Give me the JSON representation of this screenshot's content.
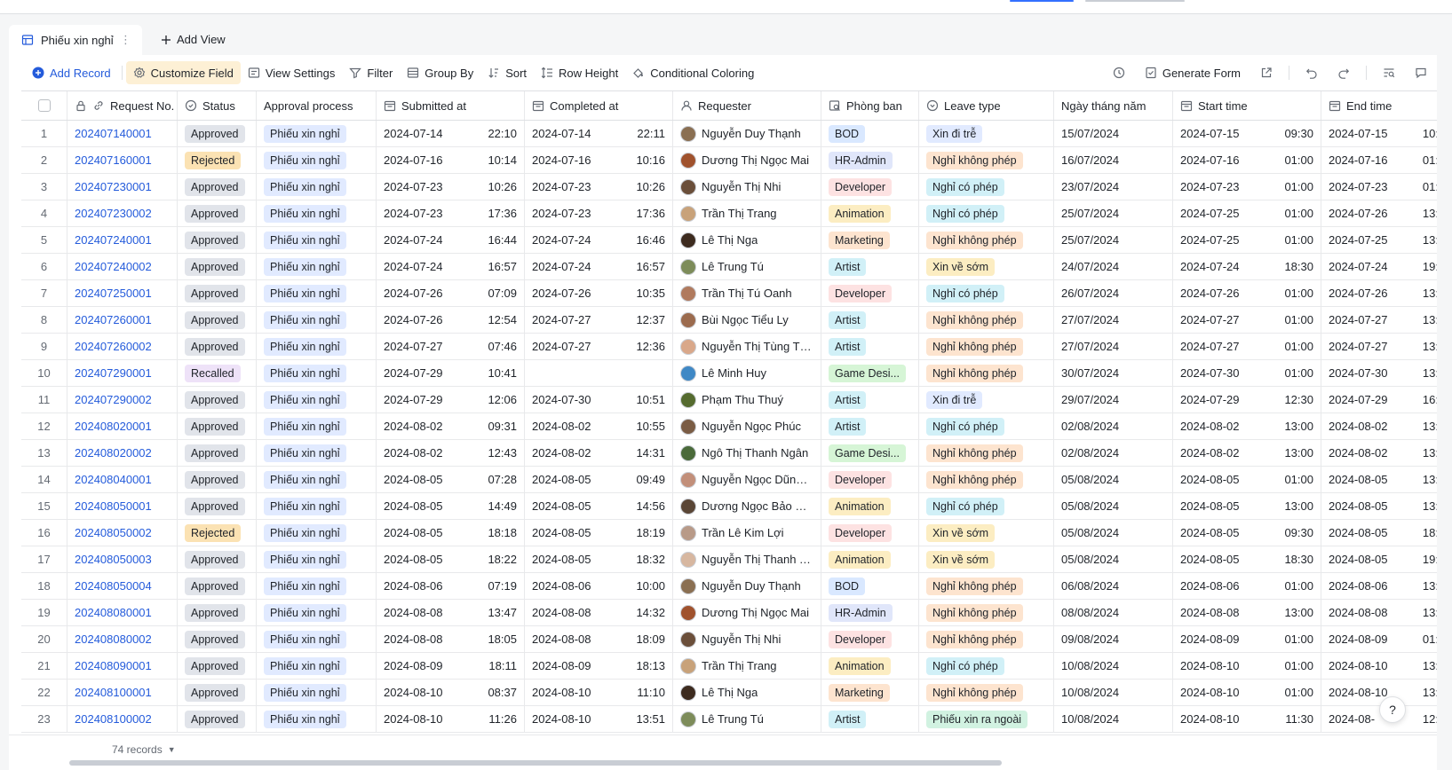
{
  "tabs": {
    "active_label": "Phiếu xin nghỉ",
    "add_view_label": "Add View"
  },
  "toolbar": {
    "add_record": "Add Record",
    "customize_field": "Customize Field",
    "view_settings": "View Settings",
    "filter": "Filter",
    "group_by": "Group By",
    "sort": "Sort",
    "row_height": "Row Height",
    "conditional_coloring": "Conditional Coloring",
    "generate_form": "Generate Form"
  },
  "columns": {
    "request_no": "Request No.",
    "status": "Status",
    "approval_process": "Approval process",
    "submitted_at": "Submitted at",
    "completed_at": "Completed at",
    "requester": "Requester",
    "phong_ban": "Phòng ban",
    "leave_type": "Leave type",
    "ngay_thang_nam": "Ngày tháng năm",
    "start_time": "Start time",
    "end_time": "End time"
  },
  "rows": [
    {
      "idx": "1",
      "req": "202407140001",
      "status": "Approved",
      "flow": "Phiếu xin nghỉ",
      "sub_d": "2024-07-14",
      "sub_t": "22:10",
      "comp_d": "2024-07-14",
      "comp_t": "22:11",
      "name": "Nguyễn Duy Thạnh",
      "dept": "BOD",
      "leave": "Xin đi trễ",
      "ngay": "15/07/2024",
      "st_d": "2024-07-15",
      "st_t": "09:30",
      "et_d": "2024-07-15",
      "et_t": "10:"
    },
    {
      "idx": "2",
      "req": "202407160001",
      "status": "Rejected",
      "flow": "Phiếu xin nghỉ",
      "sub_d": "2024-07-16",
      "sub_t": "10:14",
      "comp_d": "2024-07-16",
      "comp_t": "10:16",
      "name": "Dương Thị Ngọc Mai",
      "dept": "HR-Admin",
      "leave": "Nghỉ không phép",
      "ngay": "16/07/2024",
      "st_d": "2024-07-16",
      "st_t": "01:00",
      "et_d": "2024-07-16",
      "et_t": "01:"
    },
    {
      "idx": "3",
      "req": "202407230001",
      "status": "Approved",
      "flow": "Phiếu xin nghỉ",
      "sub_d": "2024-07-23",
      "sub_t": "10:26",
      "comp_d": "2024-07-23",
      "comp_t": "10:26",
      "name": "Nguyễn Thị  Nhi",
      "dept": "Developer",
      "leave": "Nghỉ có phép",
      "ngay": "23/07/2024",
      "st_d": "2024-07-23",
      "st_t": "01:00",
      "et_d": "2024-07-23",
      "et_t": "01:"
    },
    {
      "idx": "4",
      "req": "202407230002",
      "status": "Approved",
      "flow": "Phiếu xin nghỉ",
      "sub_d": "2024-07-23",
      "sub_t": "17:36",
      "comp_d": "2024-07-23",
      "comp_t": "17:36",
      "name": "Trần Thị Trang",
      "dept": "Animation",
      "leave": "Nghỉ có phép",
      "ngay": "25/07/2024",
      "st_d": "2024-07-25",
      "st_t": "01:00",
      "et_d": "2024-07-26",
      "et_t": "13:"
    },
    {
      "idx": "5",
      "req": "202407240001",
      "status": "Approved",
      "flow": "Phiếu xin nghỉ",
      "sub_d": "2024-07-24",
      "sub_t": "16:44",
      "comp_d": "2024-07-24",
      "comp_t": "16:46",
      "name": "Lê Thị Nga",
      "dept": "Marketing",
      "leave": "Nghỉ không phép",
      "ngay": "25/07/2024",
      "st_d": "2024-07-25",
      "st_t": "01:00",
      "et_d": "2024-07-25",
      "et_t": "13:"
    },
    {
      "idx": "6",
      "req": "202407240002",
      "status": "Approved",
      "flow": "Phiếu xin nghỉ",
      "sub_d": "2024-07-24",
      "sub_t": "16:57",
      "comp_d": "2024-07-24",
      "comp_t": "16:57",
      "name": "Lê Trung Tú",
      "dept": "Artist",
      "leave": "Xin về sớm",
      "ngay": "24/07/2024",
      "st_d": "2024-07-24",
      "st_t": "18:30",
      "et_d": "2024-07-24",
      "et_t": "19:"
    },
    {
      "idx": "7",
      "req": "202407250001",
      "status": "Approved",
      "flow": "Phiếu xin nghỉ",
      "sub_d": "2024-07-26",
      "sub_t": "07:09",
      "comp_d": "2024-07-26",
      "comp_t": "10:35",
      "name": "Trần Thị Tú Oanh",
      "dept": "Developer",
      "leave": "Nghỉ có phép",
      "ngay": "26/07/2024",
      "st_d": "2024-07-26",
      "st_t": "01:00",
      "et_d": "2024-07-26",
      "et_t": "13:"
    },
    {
      "idx": "8",
      "req": "202407260001",
      "status": "Approved",
      "flow": "Phiếu xin nghỉ",
      "sub_d": "2024-07-26",
      "sub_t": "12:54",
      "comp_d": "2024-07-27",
      "comp_t": "12:37",
      "name": "Bùi Ngọc Tiểu Ly",
      "dept": "Artist",
      "leave": "Nghỉ không phép",
      "ngay": "27/07/2024",
      "st_d": "2024-07-27",
      "st_t": "01:00",
      "et_d": "2024-07-27",
      "et_t": "13:"
    },
    {
      "idx": "9",
      "req": "202407260002",
      "status": "Approved",
      "flow": "Phiếu xin nghỉ",
      "sub_d": "2024-07-27",
      "sub_t": "07:46",
      "comp_d": "2024-07-27",
      "comp_t": "12:36",
      "name": "Nguyễn Thị Tùng Thi...",
      "dept": "Artist",
      "leave": "Nghỉ không phép",
      "ngay": "27/07/2024",
      "st_d": "2024-07-27",
      "st_t": "01:00",
      "et_d": "2024-07-27",
      "et_t": "13:"
    },
    {
      "idx": "10",
      "req": "202407290001",
      "status": "Recalled",
      "flow": "Phiếu xin nghỉ",
      "sub_d": "2024-07-29",
      "sub_t": "10:41",
      "comp_d": "",
      "comp_t": "",
      "name": "Lê Minh Huy",
      "dept": "Game Desi...",
      "leave": "Nghỉ không phép",
      "ngay": "30/07/2024",
      "st_d": "2024-07-30",
      "st_t": "01:00",
      "et_d": "2024-07-30",
      "et_t": "13:"
    },
    {
      "idx": "11",
      "req": "202407290002",
      "status": "Approved",
      "flow": "Phiếu xin nghỉ",
      "sub_d": "2024-07-29",
      "sub_t": "12:06",
      "comp_d": "2024-07-30",
      "comp_t": "10:51",
      "name": "Phạm Thu Thuý",
      "dept": "Artist",
      "leave": "Xin đi trễ",
      "ngay": "29/07/2024",
      "st_d": "2024-07-29",
      "st_t": "12:30",
      "et_d": "2024-07-29",
      "et_t": "16:"
    },
    {
      "idx": "12",
      "req": "202408020001",
      "status": "Approved",
      "flow": "Phiếu xin nghỉ",
      "sub_d": "2024-08-02",
      "sub_t": "09:31",
      "comp_d": "2024-08-02",
      "comp_t": "10:55",
      "name": "Nguyễn Ngọc Phúc",
      "dept": "Artist",
      "leave": "Nghỉ có phép",
      "ngay": "02/08/2024",
      "st_d": "2024-08-02",
      "st_t": "13:00",
      "et_d": "2024-08-02",
      "et_t": "13:"
    },
    {
      "idx": "13",
      "req": "202408020002",
      "status": "Approved",
      "flow": "Phiếu xin nghỉ",
      "sub_d": "2024-08-02",
      "sub_t": "12:43",
      "comp_d": "2024-08-02",
      "comp_t": "14:31",
      "name": "Ngô Thị Thanh Ngân",
      "dept": "Game Desi...",
      "leave": "Nghỉ không phép",
      "ngay": "02/08/2024",
      "st_d": "2024-08-02",
      "st_t": "13:00",
      "et_d": "2024-08-02",
      "et_t": "13:"
    },
    {
      "idx": "14",
      "req": "202408040001",
      "status": "Approved",
      "flow": "Phiếu xin nghỉ",
      "sub_d": "2024-08-05",
      "sub_t": "07:28",
      "comp_d": "2024-08-05",
      "comp_t": "09:49",
      "name": "Nguyễn Ngọc Dũng_...",
      "dept": "Developer",
      "leave": "Nghỉ không phép",
      "ngay": "05/08/2024",
      "st_d": "2024-08-05",
      "st_t": "01:00",
      "et_d": "2024-08-05",
      "et_t": "13:"
    },
    {
      "idx": "15",
      "req": "202408050001",
      "status": "Approved",
      "flow": "Phiếu xin nghỉ",
      "sub_d": "2024-08-05",
      "sub_t": "14:49",
      "comp_d": "2024-08-05",
      "comp_t": "14:56",
      "name": "Dương Ngọc Bảo Bảo",
      "dept": "Animation",
      "leave": "Nghỉ có phép",
      "ngay": "05/08/2024",
      "st_d": "2024-08-05",
      "st_t": "13:00",
      "et_d": "2024-08-05",
      "et_t": "13:"
    },
    {
      "idx": "16",
      "req": "202408050002",
      "status": "Rejected",
      "flow": "Phiếu xin nghỉ",
      "sub_d": "2024-08-05",
      "sub_t": "18:18",
      "comp_d": "2024-08-05",
      "comp_t": "18:19",
      "name": "Trần Lê Kim Lợi",
      "dept": "Developer",
      "leave": "Xin về sớm",
      "ngay": "05/08/2024",
      "st_d": "2024-08-05",
      "st_t": "09:30",
      "et_d": "2024-08-05",
      "et_t": "18:"
    },
    {
      "idx": "17",
      "req": "202408050003",
      "status": "Approved",
      "flow": "Phiếu xin nghỉ",
      "sub_d": "2024-08-05",
      "sub_t": "18:22",
      "comp_d": "2024-08-05",
      "comp_t": "18:32",
      "name": "Nguyễn Thị Thanh Thư",
      "dept": "Animation",
      "leave": "Xin về sớm",
      "ngay": "05/08/2024",
      "st_d": "2024-08-05",
      "st_t": "18:30",
      "et_d": "2024-08-05",
      "et_t": "19:"
    },
    {
      "idx": "18",
      "req": "202408050004",
      "status": "Approved",
      "flow": "Phiếu xin nghỉ",
      "sub_d": "2024-08-06",
      "sub_t": "07:19",
      "comp_d": "2024-08-06",
      "comp_t": "10:00",
      "name": "Nguyễn Duy Thạnh",
      "dept": "BOD",
      "leave": "Nghỉ không phép",
      "ngay": "06/08/2024",
      "st_d": "2024-08-06",
      "st_t": "01:00",
      "et_d": "2024-08-06",
      "et_t": "13:"
    },
    {
      "idx": "19",
      "req": "202408080001",
      "status": "Approved",
      "flow": "Phiếu xin nghỉ",
      "sub_d": "2024-08-08",
      "sub_t": "13:47",
      "comp_d": "2024-08-08",
      "comp_t": "14:32",
      "name": "Dương Thị Ngọc Mai",
      "dept": "HR-Admin",
      "leave": "Nghỉ không phép",
      "ngay": "08/08/2024",
      "st_d": "2024-08-08",
      "st_t": "13:00",
      "et_d": "2024-08-08",
      "et_t": "13:"
    },
    {
      "idx": "20",
      "req": "202408080002",
      "status": "Approved",
      "flow": "Phiếu xin nghỉ",
      "sub_d": "2024-08-08",
      "sub_t": "18:05",
      "comp_d": "2024-08-08",
      "comp_t": "18:09",
      "name": "Nguyễn Thị  Nhi",
      "dept": "Developer",
      "leave": "Nghỉ không phép",
      "ngay": "09/08/2024",
      "st_d": "2024-08-09",
      "st_t": "01:00",
      "et_d": "2024-08-09",
      "et_t": "01:"
    },
    {
      "idx": "21",
      "req": "202408090001",
      "status": "Approved",
      "flow": "Phiếu xin nghỉ",
      "sub_d": "2024-08-09",
      "sub_t": "18:11",
      "comp_d": "2024-08-09",
      "comp_t": "18:13",
      "name": "Trần Thị Trang",
      "dept": "Animation",
      "leave": "Nghỉ có phép",
      "ngay": "10/08/2024",
      "st_d": "2024-08-10",
      "st_t": "01:00",
      "et_d": "2024-08-10",
      "et_t": "13:"
    },
    {
      "idx": "22",
      "req": "202408100001",
      "status": "Approved",
      "flow": "Phiếu xin nghỉ",
      "sub_d": "2024-08-10",
      "sub_t": "08:37",
      "comp_d": "2024-08-10",
      "comp_t": "11:10",
      "name": "Lê Thị Nga",
      "dept": "Marketing",
      "leave": "Nghỉ không phép",
      "ngay": "10/08/2024",
      "st_d": "2024-08-10",
      "st_t": "01:00",
      "et_d": "2024-08-10",
      "et_t": "13:"
    },
    {
      "idx": "23",
      "req": "202408100002",
      "status": "Approved",
      "flow": "Phiếu xin nghỉ",
      "sub_d": "2024-08-10",
      "sub_t": "11:26",
      "comp_d": "2024-08-10",
      "comp_t": "13:51",
      "name": "Lê Trung Tú",
      "dept": "Artist",
      "leave": "Phiếu xin ra ngoài",
      "ngay": "10/08/2024",
      "st_d": "2024-08-10",
      "st_t": "11:30",
      "et_d": "2024-08-",
      "et_t": "12:"
    }
  ],
  "footer": {
    "records": "74 records"
  }
}
